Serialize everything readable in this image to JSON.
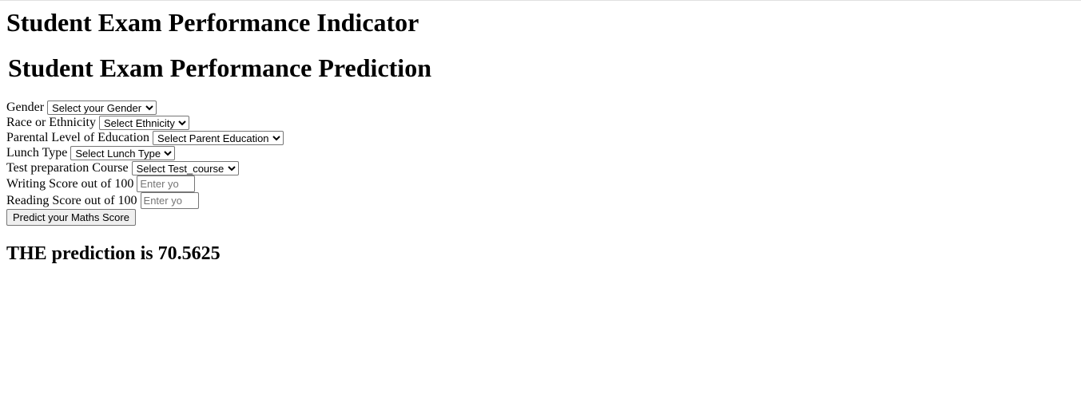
{
  "page": {
    "main_title": "Student Exam Performance Indicator",
    "form_title": "Student Exam Performance Prediction"
  },
  "form": {
    "gender": {
      "label": "Gender",
      "selected": "Select your Gender"
    },
    "ethnicity": {
      "label": "Race or Ethnicity",
      "selected": "Select Ethnicity"
    },
    "parental_education": {
      "label": "Parental Level of Education",
      "selected": "Select Parent Education"
    },
    "lunch": {
      "label": "Lunch Type",
      "selected": "Select Lunch Type"
    },
    "test_prep": {
      "label": "Test preparation Course",
      "selected": "Select Test_course"
    },
    "writing_score": {
      "label": "Writing Score out of 100",
      "value": "",
      "placeholder": "Enter yo"
    },
    "reading_score": {
      "label": "Reading Score out of 100",
      "value": "",
      "placeholder": "Enter yo"
    },
    "submit_label": "Predict your Maths Score"
  },
  "result": {
    "text": "THE prediction is 70.5625"
  }
}
